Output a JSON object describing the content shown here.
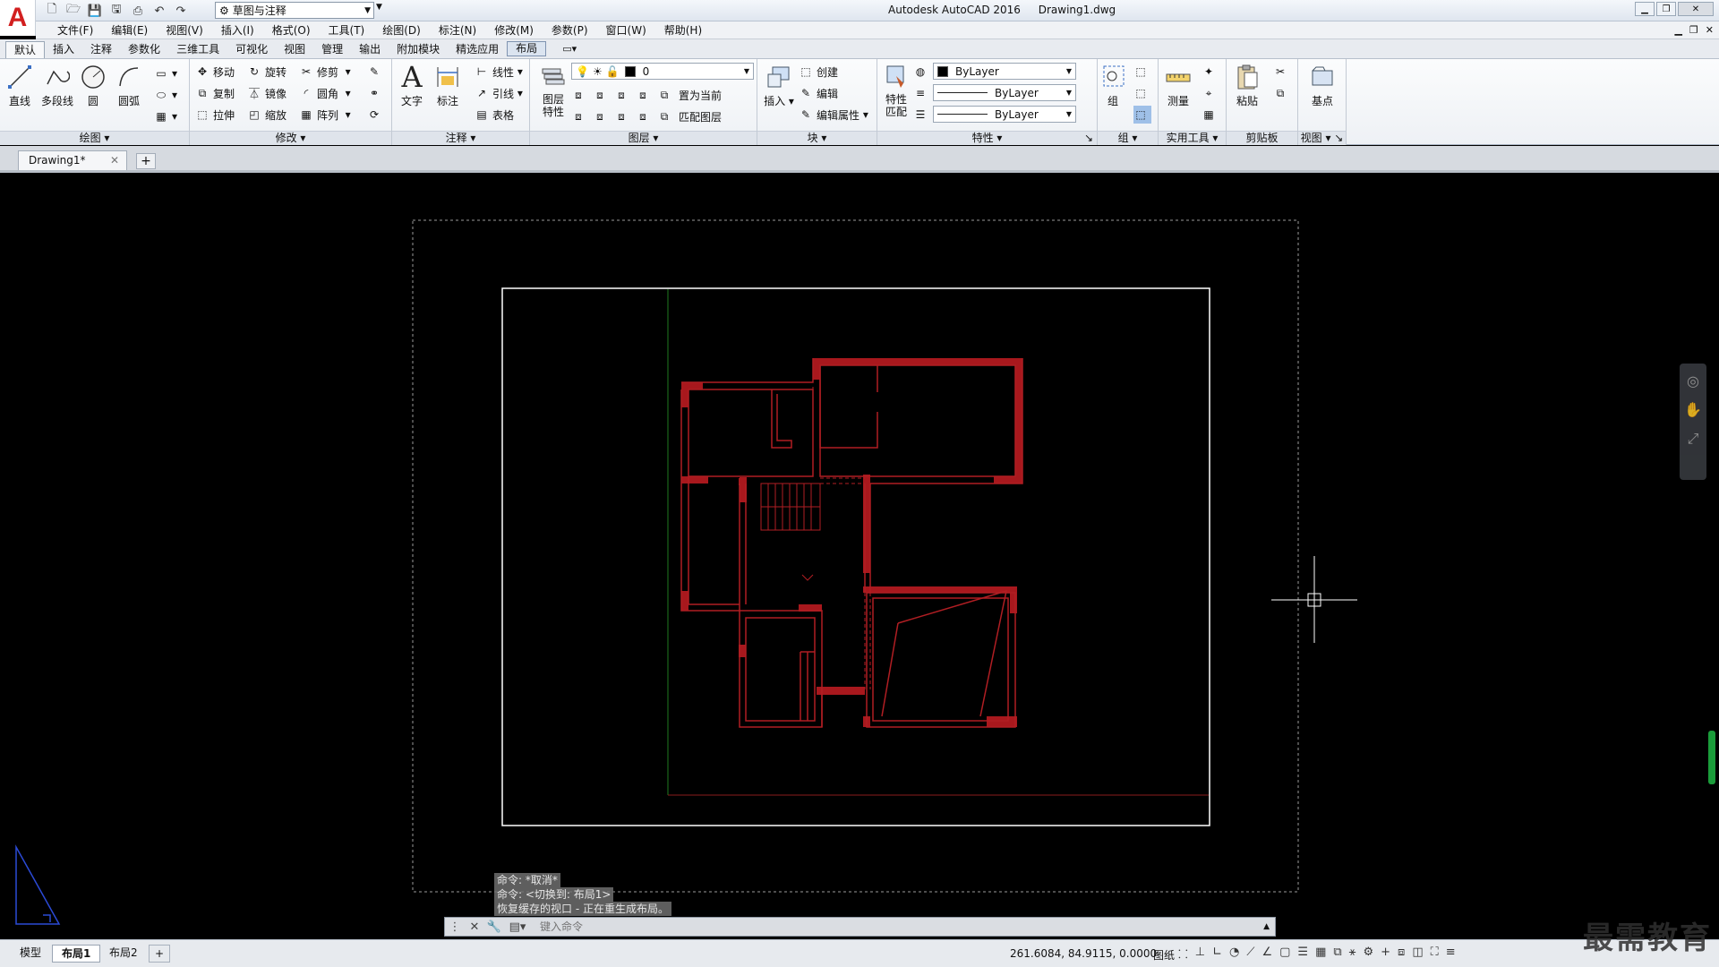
{
  "title_bar": {
    "app_name": "Autodesk AutoCAD 2016",
    "file_name": "Drawing1.dwg",
    "workspace": "草图与注释"
  },
  "menu": [
    "文件(F)",
    "编辑(E)",
    "视图(V)",
    "插入(I)",
    "格式(O)",
    "工具(T)",
    "绘图(D)",
    "标注(N)",
    "修改(M)",
    "参数(P)",
    "窗口(W)",
    "帮助(H)"
  ],
  "ribbon_tabs": [
    "默认",
    "插入",
    "注释",
    "参数化",
    "三维工具",
    "可视化",
    "视图",
    "管理",
    "输出",
    "附加模块",
    "精选应用",
    "布局"
  ],
  "panels": {
    "draw": {
      "title": "绘图",
      "line": "直线",
      "polyline": "多段线",
      "circle": "圆",
      "arc": "圆弧"
    },
    "modify": {
      "title": "修改",
      "move": "移动",
      "rotate": "旋转",
      "trim": "修剪",
      "copy": "复制",
      "mirror": "镜像",
      "fillet": "圆角",
      "stretch": "拉伸",
      "scale": "缩放",
      "array": "阵列"
    },
    "annotation": {
      "title": "注释",
      "text": "文字",
      "dimension": "标注",
      "linear": "线性",
      "leader": "引线",
      "table": "表格"
    },
    "layers": {
      "title": "图层",
      "layer_props": "图层\n特性",
      "current_layer": "0",
      "set_current": "置为当前",
      "match_layer": "匹配图层"
    },
    "block": {
      "title": "块",
      "insert": "插入",
      "create": "创建",
      "edit": "编辑",
      "edit_attr": "编辑属性"
    },
    "properties": {
      "title": "特性",
      "match": "特性\n匹配",
      "color": "ByLayer",
      "linetype": "ByLayer",
      "lineweight": "ByLayer"
    },
    "groups": {
      "title": "组",
      "group": "组"
    },
    "utilities": {
      "title": "实用工具",
      "measure": "测量"
    },
    "clipboard": {
      "title": "剪贴板",
      "paste": "粘贴"
    },
    "view": {
      "title": "视图",
      "base": "基点"
    }
  },
  "file_tab": "Drawing1*",
  "command_history": [
    "命令: *取消*",
    "命令:   <切换到: 布局1>",
    "恢复缓存的视口 - 正在重生成布局。"
  ],
  "command_prompt": "键入命令",
  "layout_tabs": [
    "模型",
    "布局1",
    "布局2"
  ],
  "active_layout": "布局1",
  "coordinates": "261.6084, 84.9115, 0.0000",
  "paper_label": "图纸",
  "watermark": "最需教育",
  "colors": {
    "drawing_red": "#b01e23",
    "canvas_bg": "#000000",
    "paper_border": "#ffffff",
    "ucs_blue": "#2b4ad6"
  }
}
